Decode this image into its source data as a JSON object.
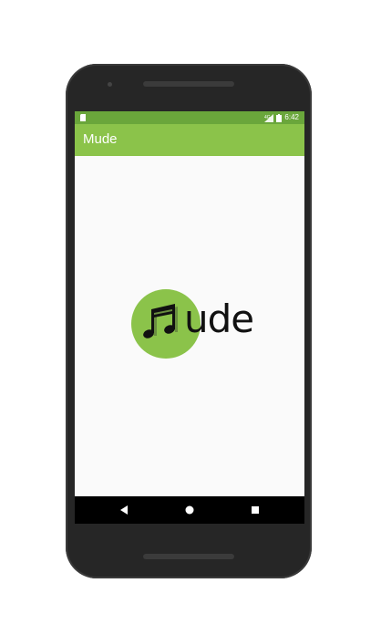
{
  "colors": {
    "accent": "#8bc34a",
    "status": "#6aa63b"
  },
  "status_bar": {
    "left_icon": "sd-card-icon",
    "signal_label": "4G",
    "time": "6:42"
  },
  "app_bar": {
    "title": "Mude"
  },
  "logo": {
    "text": "ude",
    "icon": "music-note-icon"
  },
  "nav_bar": {
    "back_icon": "back-icon",
    "home_icon": "home-icon",
    "recents_icon": "recents-icon"
  }
}
